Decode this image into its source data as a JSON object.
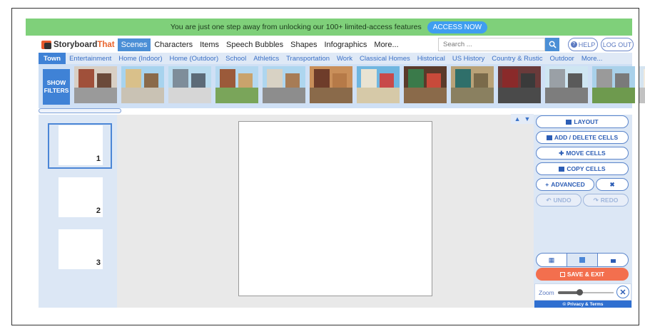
{
  "promo": {
    "text": "You are just one step away from unlocking our 100+ limited-access features",
    "button": "ACCESS NOW"
  },
  "logo": {
    "part1": "Storyboard",
    "part2": "That"
  },
  "nav": {
    "tabs": [
      "Scenes",
      "Characters",
      "Items",
      "Speech Bubbles",
      "Shapes",
      "Infographics",
      "More..."
    ],
    "active_index": 0,
    "search_placeholder": "Search ...",
    "help": "HELP",
    "logout": "LOG OUT"
  },
  "categories": {
    "items": [
      "Town",
      "Entertainment",
      "Home (Indoor)",
      "Home (Outdoor)",
      "School",
      "Athletics",
      "Transportation",
      "Work",
      "Classical Homes",
      "Historical",
      "US History",
      "Country & Rustic",
      "Outdoor",
      "More..."
    ],
    "active_index": 0
  },
  "scenes": {
    "show_filters_line1": "SHOW",
    "show_filters_line2": "FILTERS",
    "thumbnails": [
      {
        "name": "brick-rowhouses",
        "sky": "#d8cfc4",
        "ground": "#9a9a9a",
        "b1": "#a0503a",
        "b2": "#6b4a3a"
      },
      {
        "name": "storefronts",
        "sky": "#a7d3ee",
        "ground": "#c9c2b4",
        "b1": "#d9c08a",
        "b2": "#8a6a4a"
      },
      {
        "name": "city-skyline",
        "sky": "#b9dcef",
        "ground": "#d6d6d6",
        "b1": "#7e8d9a",
        "b2": "#5c6b78"
      },
      {
        "name": "park-street",
        "sky": "#b4d8f0",
        "ground": "#7aa55a",
        "b1": "#9b5a3a",
        "b2": "#c9a36c"
      },
      {
        "name": "main-street",
        "sky": "#aed6ef",
        "ground": "#8d8d8d",
        "b1": "#d8d2c4",
        "b2": "#a77c56"
      },
      {
        "name": "doorway",
        "sky": "#c98f5a",
        "ground": "#8a6a4a",
        "b1": "#6e3c2a",
        "b2": "#b67a48"
      },
      {
        "name": "cafe-patio",
        "sky": "#6fb6e0",
        "ground": "#d6c9a8",
        "b1": "#e9e3d2",
        "b2": "#c84a4a"
      },
      {
        "name": "shop-window",
        "sky": "#5a3a2a",
        "ground": "#8a6a4a",
        "b1": "#3a7a4a",
        "b2": "#c84a3a"
      },
      {
        "name": "alley-door",
        "sky": "#b9a278",
        "ground": "#8a8060",
        "b1": "#2f6f6a",
        "b2": "#7a6a4a"
      },
      {
        "name": "graffiti-wall",
        "sky": "#6a3a3a",
        "ground": "#4a4a4a",
        "b1": "#8a2a2a",
        "b2": "#3a3a3a"
      },
      {
        "name": "parking-lot",
        "sky": "#cfe6f2",
        "ground": "#7d7d7d",
        "b1": "#9aa0a6",
        "b2": "#5a5a5a"
      },
      {
        "name": "cemetery",
        "sky": "#a9d1ea",
        "ground": "#6e9a4e",
        "b1": "#9a9a9a",
        "b2": "#7a7a7a"
      },
      {
        "name": "diner",
        "sky": "#d5e4f0",
        "ground": "#c2c2c2",
        "b1": "#f2ece0",
        "b2": "#b23a3a"
      },
      {
        "name": "partial-scene",
        "sky": "#c9b28a",
        "ground": "#8a7a5a",
        "b1": "#5a4a3a",
        "b2": "#3a3a3a"
      }
    ]
  },
  "cells": [
    {
      "number": "1",
      "selected": true
    },
    {
      "number": "2",
      "selected": false
    },
    {
      "number": "3",
      "selected": false
    }
  ],
  "tools": {
    "layout": "LAYOUT",
    "add_delete": "ADD / DELETE CELLS",
    "move": "MOVE CELLS",
    "copy": "COPY CELLS",
    "advanced": "ADVANCED",
    "undo": "UNDO",
    "redo": "REDO",
    "save_exit": "SAVE & EXIT",
    "zoom_label": "Zoom",
    "zoom_level": 0.38,
    "privacy": "© Privacy & Terms"
  },
  "colors": {
    "accent": "#4b8fd6",
    "promo_bg": "#7fd07a",
    "save": "#f36f4e",
    "panel": "#dce7f5"
  }
}
